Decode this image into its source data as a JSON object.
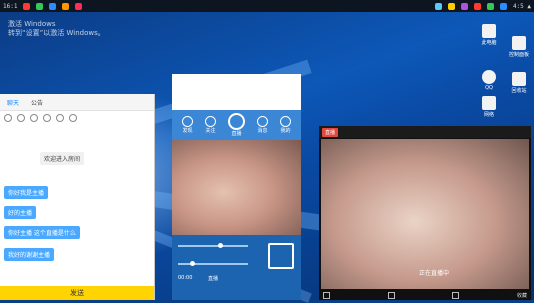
{
  "taskbar": {
    "time_text": "16:1",
    "icon_colors": [
      "#ff3b30",
      "#34c759",
      "#2b8cff",
      "#ff9500",
      "#ff2d55",
      "#5ac8fa",
      "#ffcc00",
      "#af52de"
    ],
    "tray_label": "4:5 ▲"
  },
  "desktop": {
    "watermark_lines": [
      "激活 Windows",
      "转到“设置”以激活 Windows。"
    ],
    "icons": [
      {
        "label": "此电脑",
        "name": "this-pc-icon"
      },
      {
        "label": "QQ",
        "name": "qq-icon"
      },
      {
        "label": "网络",
        "name": "network-icon"
      },
      {
        "label": "控制面板",
        "name": "control-panel-icon"
      },
      {
        "label": "回收站",
        "name": "recycle-bin-icon"
      }
    ]
  },
  "chat": {
    "tabs": [
      "聊天",
      "公告"
    ],
    "messages": [
      {
        "text": "你好我是主播",
        "style": "blue"
      },
      {
        "text": "欢迎进入房间",
        "style": "gray"
      },
      {
        "text": "好的主播",
        "style": "blue"
      },
      {
        "text": "你好主播 这个直播是什么",
        "style": "blue"
      },
      {
        "text": "我好的谢谢主播",
        "style": "blue"
      }
    ],
    "send_label": "发送"
  },
  "app": {
    "nav_labels": [
      "发现",
      "关注",
      "直播",
      "消息",
      "我的"
    ],
    "ctrl_time": "00:00",
    "ctrl_label": "直播"
  },
  "viewer": {
    "record_label": "直播",
    "caption": "正在直播中",
    "foot_text": "收藏"
  }
}
